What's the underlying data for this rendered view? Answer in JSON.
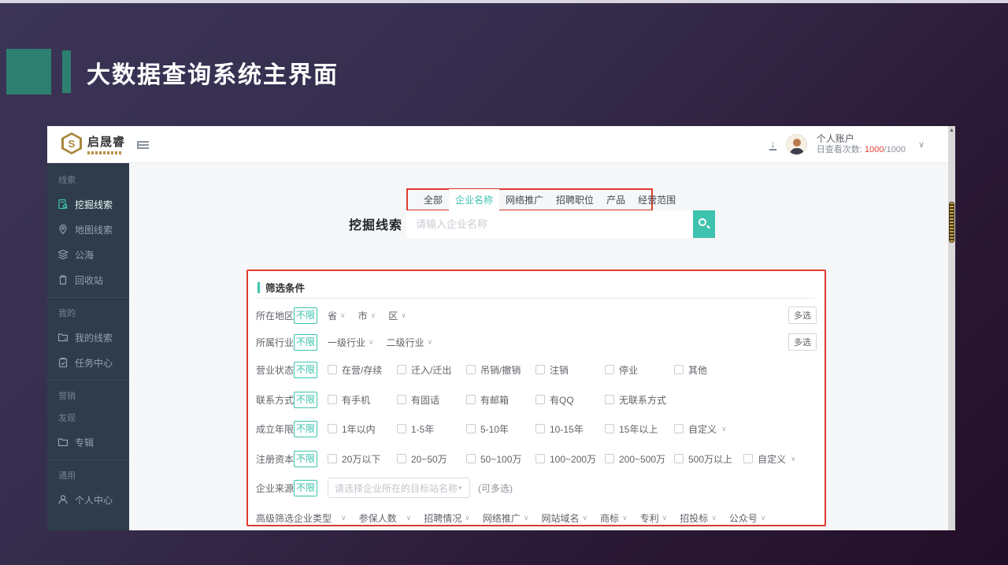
{
  "slide": {
    "title": "大数据查询系统主界面"
  },
  "colors": {
    "accent": "#3fc3ae",
    "annotation_red": "#df3b2e",
    "quota_red": "#e23c30",
    "brand_gold": "#a8873b"
  },
  "header": {
    "brand_name": "启晟睿",
    "brand_logo_letter": "S",
    "account_name": "个人账户",
    "quota_label": "日查看次数:",
    "quota_used": "1000",
    "quota_total": "/1000"
  },
  "sidebar": {
    "sections": [
      {
        "header": "线索",
        "items": [
          {
            "label": "挖掘线索",
            "icon": "doc-search-icon",
            "active": true
          },
          {
            "label": "地图线索",
            "icon": "map-pin-icon"
          },
          {
            "label": "公海",
            "icon": "layers-icon"
          },
          {
            "label": "回收站",
            "icon": "trash-icon"
          }
        ]
      },
      {
        "header": "我的",
        "items": [
          {
            "label": "我的线索",
            "icon": "folder-tree-icon"
          },
          {
            "label": "任务中心",
            "icon": "clipboard-icon"
          }
        ]
      },
      {
        "header": "营销",
        "items": []
      },
      {
        "header": "发现",
        "items": [
          {
            "label": "专辑",
            "icon": "folder-icon"
          }
        ]
      },
      {
        "header": "通用",
        "items": [
          {
            "label": "个人中心",
            "icon": "user-icon"
          }
        ]
      }
    ]
  },
  "search": {
    "tabs": [
      {
        "label": "全部"
      },
      {
        "label": "企业名称",
        "active": true
      },
      {
        "label": "网络推广"
      },
      {
        "label": "招聘职位"
      },
      {
        "label": "产品"
      },
      {
        "label": "经营范围"
      }
    ],
    "title": "挖掘线索",
    "placeholder": "请输入企业名称"
  },
  "filters": {
    "panel_title": "筛选条件",
    "unlimited": "不限",
    "multi_select": "多选",
    "rows": [
      {
        "label": "所在地区",
        "dropdowns": [
          "省",
          "市",
          "区"
        ]
      },
      {
        "label": "所属行业",
        "dropdowns": [
          "一级行业",
          "二级行业"
        ]
      },
      {
        "label": "营业状态",
        "options": [
          "在营/存续",
          "迁入/迁出",
          "吊销/撤销",
          "注销",
          "停业",
          "其他"
        ]
      },
      {
        "label": "联系方式",
        "options": [
          "有手机",
          "有固话",
          "有邮箱",
          "有QQ",
          "无联系方式"
        ]
      },
      {
        "label": "成立年限",
        "options": [
          "1年以内",
          "1-5年",
          "5-10年",
          "10-15年",
          "15年以上"
        ],
        "custom": "自定义"
      },
      {
        "label": "注册资本",
        "options": [
          "20万以下",
          "20~50万",
          "50~100万",
          "100~200万",
          "200~500万",
          "500万以上"
        ],
        "custom": "自定义"
      },
      {
        "label": "企业来源",
        "select_placeholder": "请选择企业所在的目标站名称",
        "note": "(可多选)"
      },
      {
        "label": "高级筛选",
        "dropdowns": [
          "企业类型",
          "参保人数",
          "招聘情况",
          "网络推广",
          "网站域名",
          "商标",
          "专利",
          "招投标",
          "公众号"
        ]
      }
    ]
  }
}
